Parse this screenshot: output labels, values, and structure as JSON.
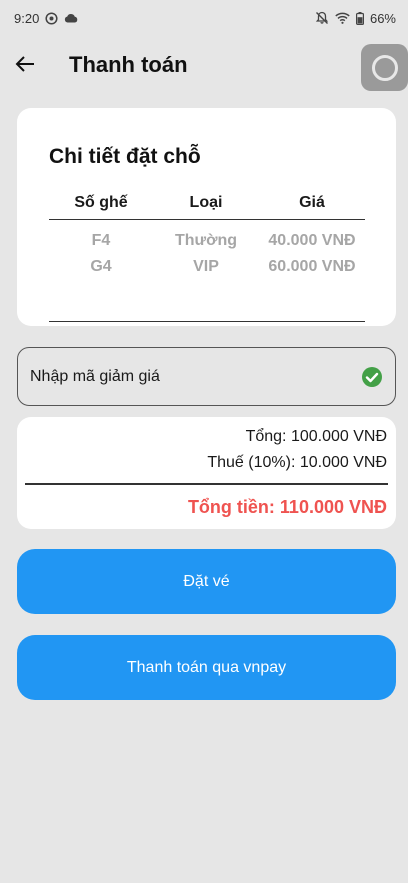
{
  "status_bar": {
    "time": "9:20",
    "battery": "66%"
  },
  "header": {
    "title": "Thanh toán"
  },
  "booking": {
    "title": "Chi tiết đặt chỗ",
    "columns": [
      "Số ghế",
      "Loại",
      "Giá"
    ],
    "rows": [
      {
        "seat": "F4",
        "type": "Thường",
        "price": "40.000 VNĐ"
      },
      {
        "seat": "G4",
        "type": "VIP",
        "price": "60.000 VNĐ"
      }
    ]
  },
  "discount": {
    "label": "Nhập mã giảm giá",
    "status_icon": "check-circle-icon",
    "status_color": "#43a047"
  },
  "summary": {
    "total": "Tổng: 100.000 VNĐ",
    "tax": "Thuế (10%): 10.000 VNĐ",
    "grand_total": "Tổng tiền: 110.000 VNĐ",
    "grand_total_color": "#ef5350"
  },
  "actions": {
    "book_label": "Đặt vé",
    "vnpay_label": "Thanh toán qua vnpay",
    "button_color": "#2196f3"
  }
}
